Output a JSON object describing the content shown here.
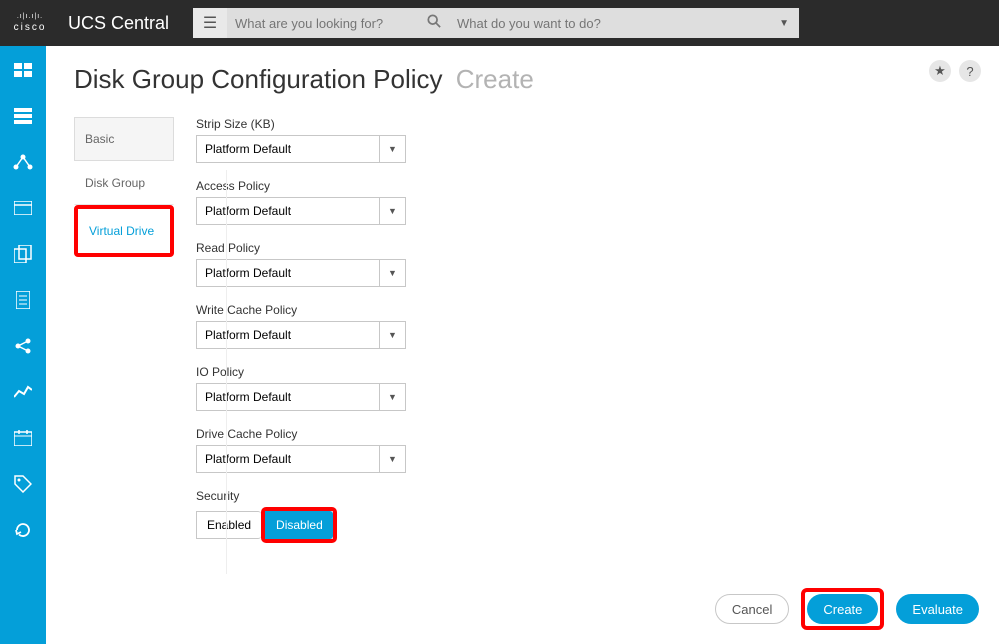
{
  "brand": {
    "name": "cisco"
  },
  "app": {
    "title": "UCS Central"
  },
  "search": {
    "placeholder": "What are you looking for?"
  },
  "action": {
    "placeholder": "What do you want to do?"
  },
  "page": {
    "title": "Disk Group Configuration Policy",
    "mode": "Create"
  },
  "rail": {
    "items": [
      "dashboard-icon",
      "servers-icon",
      "network-icon",
      "window-icon",
      "copy-icon",
      "doc-icon",
      "share-icon",
      "stats-icon",
      "calendar-icon",
      "tag-icon",
      "refresh-icon"
    ]
  },
  "tabs": {
    "basic": "Basic",
    "disk_group": "Disk Group",
    "virtual_drive": "Virtual Drive"
  },
  "fields": {
    "strip_size": {
      "label": "Strip Size (KB)",
      "value": "Platform Default"
    },
    "access_policy": {
      "label": "Access Policy",
      "value": "Platform Default"
    },
    "read_policy": {
      "label": "Read Policy",
      "value": "Platform Default"
    },
    "write_cache": {
      "label": "Write Cache Policy",
      "value": "Platform Default"
    },
    "io_policy": {
      "label": "IO Policy",
      "value": "Platform Default"
    },
    "drive_cache": {
      "label": "Drive Cache Policy",
      "value": "Platform Default"
    },
    "security": {
      "label": "Security",
      "enabled": "Enabled",
      "disabled": "Disabled",
      "selected": "Disabled"
    }
  },
  "buttons": {
    "cancel": "Cancel",
    "create": "Create",
    "evaluate": "Evaluate"
  },
  "head_icons": {
    "star": "★",
    "help": "?"
  }
}
